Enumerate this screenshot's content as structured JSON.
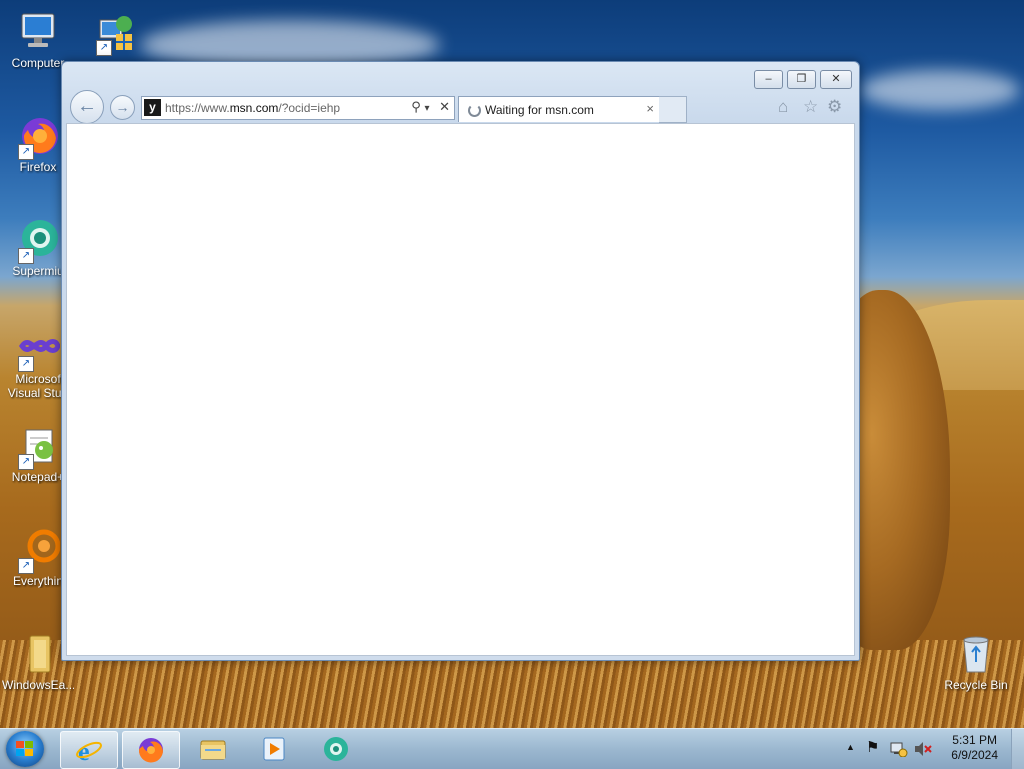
{
  "desktop": {
    "icons": [
      {
        "label": "Computer",
        "icon": "computer-icon"
      },
      {
        "label": "",
        "icon": "network-icon"
      },
      {
        "label": "Firefox",
        "icon": "firefox-icon"
      },
      {
        "label": "Supermiu",
        "icon": "supermium-icon"
      },
      {
        "label": "Microsof",
        "label2": "Visual Stud",
        "icon": "visual-studio-icon"
      },
      {
        "label": "Notepad+",
        "icon": "notepadpp-icon"
      },
      {
        "label": "Everythin",
        "icon": "everything-icon"
      },
      {
        "label": "WindowsEa...",
        "icon": "folder-icon"
      },
      {
        "label": "Recycle Bin",
        "icon": "recycle-bin-icon"
      }
    ]
  },
  "browser": {
    "address": {
      "prefix": "https://www.",
      "host": "msn.com",
      "suffix": "/?ocid=iehp",
      "search_glyph": "⚲",
      "dropdown_glyph": "▾",
      "stop_glyph": "✕"
    },
    "tab": {
      "title": "Waiting for msn.com",
      "close_glyph": "×"
    },
    "window_controls": {
      "minimize": "–",
      "restore": "❐",
      "close": "✕"
    },
    "command_icons": {
      "home": "⌂",
      "favorites": "☆",
      "tools": "⚙"
    },
    "nav": {
      "back": "←",
      "forward": "→"
    },
    "favicon": "y"
  },
  "taskbar": {
    "apps": [
      {
        "name": "Internet Explorer",
        "icon": "internet-explorer-icon"
      },
      {
        "name": "Firefox",
        "icon": "firefox-icon"
      },
      {
        "name": "Windows Explorer",
        "icon": "file-explorer-icon"
      },
      {
        "name": "Windows Media Player",
        "icon": "media-player-icon"
      },
      {
        "name": "Supermium",
        "icon": "supermium-icon"
      }
    ],
    "tray": {
      "show_hidden": "▲",
      "flag": "⚑"
    },
    "clock": {
      "time": "5:31 PM",
      "date": "6/9/2024"
    }
  },
  "colors": {
    "accent": "#2a7fd0",
    "window_frame": "#c9d9ec",
    "taskbar": "#96b4cd"
  }
}
